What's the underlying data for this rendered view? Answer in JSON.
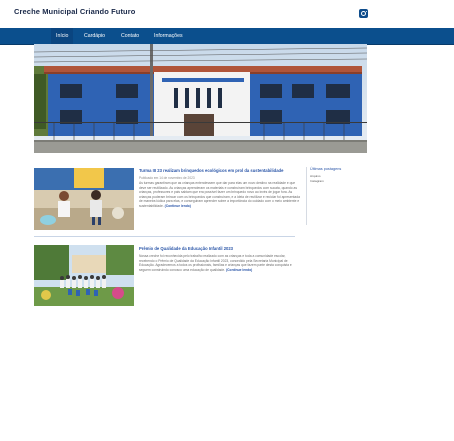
{
  "site": {
    "title": "Creche Municipal Criando Futuro"
  },
  "nav": {
    "items": [
      {
        "label": "Início",
        "active": true
      },
      {
        "label": "Cardápio"
      },
      {
        "label": "Contato"
      },
      {
        "label": "Informações"
      }
    ]
  },
  "icons": {
    "instagram": "instagram-icon"
  },
  "colors": {
    "nav_bg": "#0b4f8d",
    "link": "#2b56a8"
  },
  "posts": [
    {
      "title": "Turma III 23 realizam brinquedos ecológicos em prol da sustentabilidade",
      "meta": "Publicado em 14 de novembro de 2023",
      "excerpt": "As turmas garantiram que as crianças entendessem que dar para elas um novo destino na realidade e que deve ser reutilizado. As crianças aprenderam os materiais e construíram brinquedos com sucata, quando as crianças, professores e pais sabiam que era possível fazer um brinquedo novo ao invés de jogar fora. As crianças puderam brincar com os brinquedos que construíram, e a ideia de reutilizar e reciclar foi apresentada de maneira lúdica para elas, e conseguiram aprender sobre a importância do cuidado com o meio ambiente e sustentabilidade.",
      "read_more": "(Continue lendo)"
    },
    {
      "title": "Prêmio de Qualidade da Educação Infantil 2023",
      "meta": "",
      "excerpt": "Nossa creche foi reconhecida pelo trabalho realizado com as crianças e toda a comunidade escolar, recebendo o Prêmio de Qualidade da Educação Infantil 2023, concedido pela Secretaria Municipal de Educação. Agradecemos a todos os profissionais, famílias e crianças que fazem parte desta conquista e seguem construindo conosco uma educação de qualidade.",
      "read_more": "(Continue lendo)"
    }
  ],
  "sidebar": {
    "title": "Últimas postagens",
    "links": [
      "Arquivo",
      "Instagram"
    ]
  }
}
